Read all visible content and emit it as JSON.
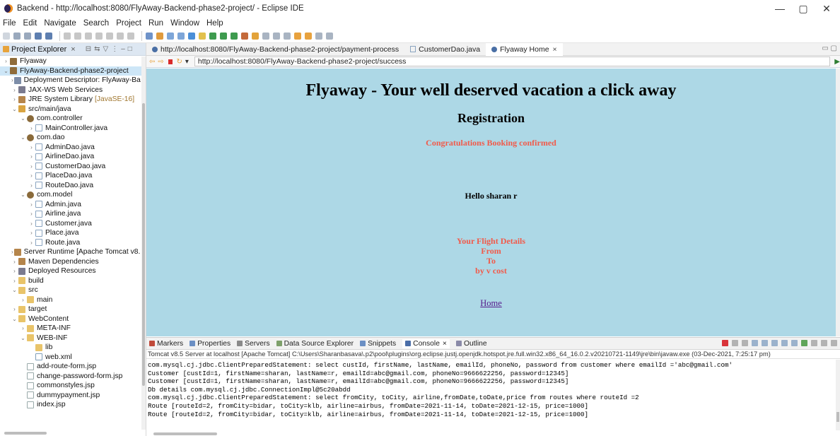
{
  "window": {
    "title": "Backend - http://localhost:8080/FlyAway-Backend-phase2-project/ - Eclipse IDE",
    "minimize": "—",
    "maximize": "▢",
    "close": "✕"
  },
  "menu": [
    "File",
    "Edit",
    "Navigate",
    "Search",
    "Project",
    "Run",
    "Window",
    "Help"
  ],
  "project_explorer": {
    "tab_label": "Project Explorer",
    "tab_close": "×",
    "tree": [
      {
        "level": 0,
        "twisty": "›",
        "icon": "i-project",
        "label": "Flyaway",
        "deco": ""
      },
      {
        "level": 0,
        "twisty": "⌄",
        "icon": "i-project",
        "label": "FlyAway-Backend-phase2-project",
        "deco": "",
        "selected": true
      },
      {
        "level": 1,
        "twisty": "›",
        "icon": "i-desc",
        "label": "Deployment Descriptor: FlyAway-Ba",
        "deco": ""
      },
      {
        "level": 1,
        "twisty": "›",
        "icon": "i-ws",
        "label": "JAX-WS Web Services",
        "deco": ""
      },
      {
        "level": 1,
        "twisty": "›",
        "icon": "i-lib",
        "label": "JRE System Library",
        "deco": "[JavaSE-16]"
      },
      {
        "level": 1,
        "twisty": "⌄",
        "icon": "i-srcfolder",
        "label": "src/main/java",
        "deco": ""
      },
      {
        "level": 2,
        "twisty": "⌄",
        "icon": "i-package",
        "label": "com.controller",
        "deco": ""
      },
      {
        "level": 3,
        "twisty": "›",
        "icon": "i-java",
        "label": "MainController.java",
        "deco": ""
      },
      {
        "level": 2,
        "twisty": "⌄",
        "icon": "i-package",
        "label": "com.dao",
        "deco": ""
      },
      {
        "level": 3,
        "twisty": "›",
        "icon": "i-java",
        "label": "AdminDao.java",
        "deco": ""
      },
      {
        "level": 3,
        "twisty": "›",
        "icon": "i-java",
        "label": "AirlineDao.java",
        "deco": ""
      },
      {
        "level": 3,
        "twisty": "›",
        "icon": "i-java",
        "label": "CustomerDao.java",
        "deco": ""
      },
      {
        "level": 3,
        "twisty": "›",
        "icon": "i-java",
        "label": "PlaceDao.java",
        "deco": ""
      },
      {
        "level": 3,
        "twisty": "›",
        "icon": "i-java",
        "label": "RouteDao.java",
        "deco": ""
      },
      {
        "level": 2,
        "twisty": "⌄",
        "icon": "i-package",
        "label": "com.model",
        "deco": ""
      },
      {
        "level": 3,
        "twisty": "›",
        "icon": "i-java",
        "label": "Admin.java",
        "deco": ""
      },
      {
        "level": 3,
        "twisty": "›",
        "icon": "i-java",
        "label": "Airline.java",
        "deco": ""
      },
      {
        "level": 3,
        "twisty": "›",
        "icon": "i-java",
        "label": "Customer.java",
        "deco": ""
      },
      {
        "level": 3,
        "twisty": "›",
        "icon": "i-java",
        "label": "Place.java",
        "deco": ""
      },
      {
        "level": 3,
        "twisty": "›",
        "icon": "i-java",
        "label": "Route.java",
        "deco": ""
      },
      {
        "level": 1,
        "twisty": "›",
        "icon": "i-lib",
        "label": "Server Runtime [Apache Tomcat v8.",
        "deco": ""
      },
      {
        "level": 1,
        "twisty": "›",
        "icon": "i-lib",
        "label": "Maven Dependencies",
        "deco": ""
      },
      {
        "level": 1,
        "twisty": "›",
        "icon": "i-ws",
        "label": "Deployed Resources",
        "deco": ""
      },
      {
        "level": 1,
        "twisty": "›",
        "icon": "i-folder",
        "label": "build",
        "deco": ""
      },
      {
        "level": 1,
        "twisty": "⌄",
        "icon": "i-folder",
        "label": "src",
        "deco": ""
      },
      {
        "level": 2,
        "twisty": "›",
        "icon": "i-folder",
        "label": "main",
        "deco": ""
      },
      {
        "level": 1,
        "twisty": "›",
        "icon": "i-folder",
        "label": "target",
        "deco": ""
      },
      {
        "level": 1,
        "twisty": "⌄",
        "icon": "i-folder",
        "label": "WebContent",
        "deco": ""
      },
      {
        "level": 2,
        "twisty": "›",
        "icon": "i-folder",
        "label": "META-INF",
        "deco": ""
      },
      {
        "level": 2,
        "twisty": "⌄",
        "icon": "i-folder",
        "label": "WEB-INF",
        "deco": ""
      },
      {
        "level": 3,
        "twisty": "",
        "icon": "i-folder",
        "label": "lib",
        "deco": ""
      },
      {
        "level": 3,
        "twisty": "",
        "icon": "i-xml",
        "label": "web.xml",
        "deco": ""
      },
      {
        "level": 2,
        "twisty": "",
        "icon": "i-jsp",
        "label": "add-route-form.jsp",
        "deco": ""
      },
      {
        "level": 2,
        "twisty": "",
        "icon": "i-jsp",
        "label": "change-password-form.jsp",
        "deco": ""
      },
      {
        "level": 2,
        "twisty": "",
        "icon": "i-jsp",
        "label": "commonstyles.jsp",
        "deco": ""
      },
      {
        "level": 2,
        "twisty": "",
        "icon": "i-jsp",
        "label": "dummypayment.jsp",
        "deco": ""
      },
      {
        "level": 2,
        "twisty": "",
        "icon": "i-jsp",
        "label": "index.jsp",
        "deco": ""
      }
    ]
  },
  "editor": {
    "tabs": [
      {
        "label": "http://localhost:8080/FlyAway-Backend-phase2-project/payment-process",
        "kind": "browser",
        "active": false
      },
      {
        "label": "CustomerDao.java",
        "kind": "java",
        "active": false
      },
      {
        "label": "Flyaway Home",
        "kind": "browser",
        "active": true
      }
    ],
    "tab_close": "×",
    "url": "http://localhost:8080/FlyAway-Backend-phase2-project/success"
  },
  "webpage": {
    "heading": "Flyaway - Your well deserved vacation a click away",
    "subheading": "Registration",
    "confirmation": "Congratulations Booking confirmed",
    "greeting": "Hello sharan r",
    "details_title": "Your Flight Details",
    "from": "From",
    "to": "To",
    "by": "by v cost",
    "home_link": "Home"
  },
  "console": {
    "tabs": [
      "Markers",
      "Properties",
      "Servers",
      "Data Source Explorer",
      "Snippets",
      "Console",
      "Outline"
    ],
    "active_tab": "Console",
    "console_close": "×",
    "info": "Tomcat v8.5 Server at localhost [Apache Tomcat] C:\\Users\\Sharanbasava\\.p2\\pool\\plugins\\org.eclipse.justj.openjdk.hotspot.jre.full.win32.x86_64_16.0.2.v20210721-1149\\jre\\bin\\javaw.exe  (03-Dec-2021, 7:25:17 pm)",
    "lines": [
      "com.mysql.cj.jdbc.ClientPreparedStatement: select custId, firstName, lastName, emailId, phoneNo, password from customer where emailId ='abc@gmail.com'",
      "Customer [custId=1, firstName=sharan, lastName=r, emailId=abc@gmail.com, phoneNo=9666622256, password=12345]",
      "Customer [custId=1, firstName=sharan, lastName=r, emailId=abc@gmail.com, phoneNo=9666622256, password=12345]",
      "Db details com.mysql.cj.jdbc.ConnectionImpl@5c20abdd",
      "com.mysql.cj.jdbc.ClientPreparedStatement: select fromCity, toCity, airline,fromDate,toDate,price from routes where routeId =2",
      "Route [routeId=2, fromCity=bidar, toCity=klb, airline=airbus, fromDate=2021-11-14, toDate=2021-12-15, price=1000]",
      "Route [routeId=2, fromCity=bidar, toCity=klb, airline=airbus, fromDate=2021-11-14, toDate=2021-12-15, price=1000]"
    ]
  }
}
